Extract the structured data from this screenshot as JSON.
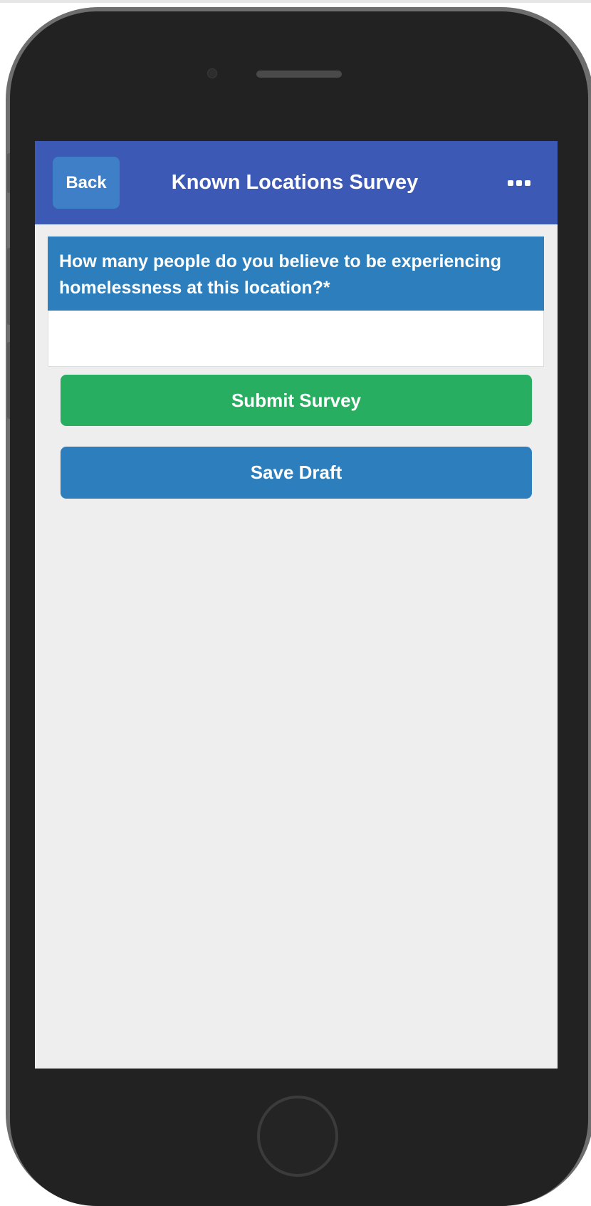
{
  "navbar": {
    "back_label": "Back",
    "title": "Known Locations Survey",
    "more_icon": "more-horizontal-icon"
  },
  "survey": {
    "question": "How many people do you believe to be experiencing homelessness at this location?*",
    "answer_value": "",
    "answer_placeholder": ""
  },
  "actions": {
    "submit_label": "Submit Survey",
    "save_label": "Save Draft"
  },
  "colors": {
    "navbar": "#3b59b5",
    "back_button": "#3f7fc7",
    "question_header": "#2c7fbc",
    "submit": "#27ae60",
    "save": "#2c7fbc",
    "screen_background": "#eeeeef"
  }
}
